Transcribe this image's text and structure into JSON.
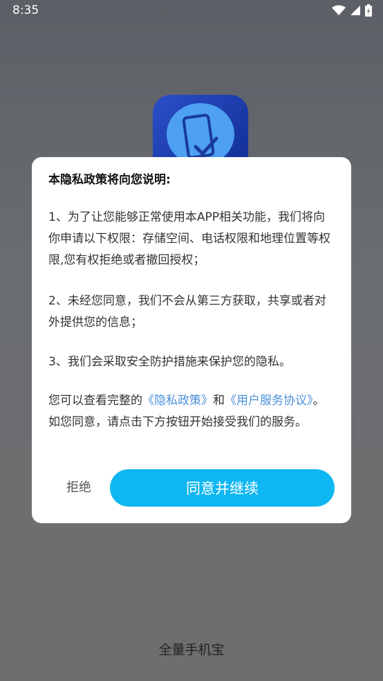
{
  "statusbar": {
    "time": "8:35"
  },
  "dialog": {
    "title": "本隐私政策将向您说明:",
    "p1": "1、为了让您能够正常使用本APP相关功能，我们将向你申请以下权限：存储空间、电话权限和地理位置等权限,您有权拒绝或者撤回授权；",
    "p2": "2、未经您同意，我们不会从第三方获取，共享或者对外提供您的信息；",
    "p3": "3、我们会采取安全防护措施来保护您的隐私。",
    "p4_prefix": "您可以查看完整的",
    "privacy_link": "《隐私政策》",
    "p4_and": "和",
    "terms_link": "《用户服务协议》",
    "p4_suffix": "。如您同意，请点击下方按钮开始接受我们的服务。",
    "reject_label": "拒绝",
    "agree_label": "同意并继续"
  },
  "app": {
    "name": "全量手机宝"
  }
}
